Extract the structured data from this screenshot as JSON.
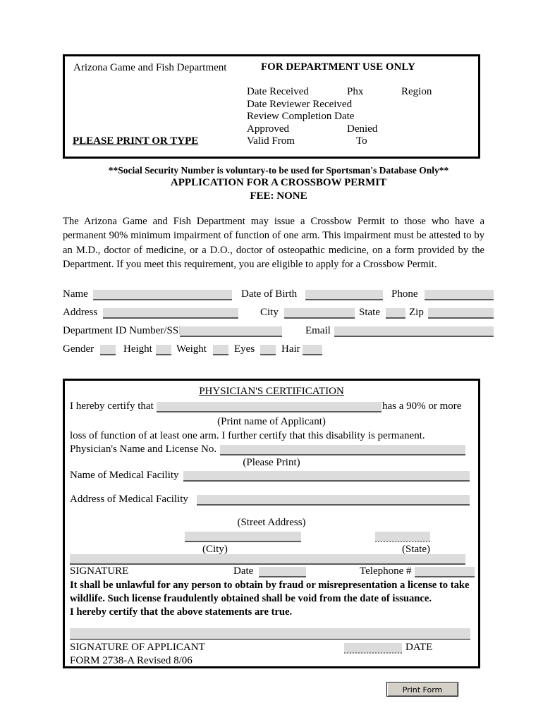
{
  "department_box": {
    "left_title": "Arizona Game and Fish Department",
    "right_title": "FOR DEPARTMENT USE ONLY",
    "please_print": "PLEASE PRINT OR TYPE",
    "rows": [
      {
        "c1": "Date Received",
        "c2": "Phx",
        "c3": "Region"
      },
      {
        "c1": "Date Reviewer Received",
        "c2": "",
        "c3": ""
      },
      {
        "c1": "Review Completion Date",
        "c2": "",
        "c3": ""
      },
      {
        "c1": "Approved",
        "c2": "Denied",
        "c3": ""
      },
      {
        "c1": "Valid From",
        "c2": "To",
        "c3": ""
      }
    ]
  },
  "titles": {
    "ssn_note": "**Social Security Number is voluntary-to be used for Sportsman's Database Only**",
    "application": "APPLICATION FOR A CROSSBOW PERMIT",
    "fee": "FEE:  NONE"
  },
  "intro": "The Arizona Game and Fish Department may issue a Crossbow Permit to those who have a permanent 90% minimum impairment of function of one arm.  This impairment must be attested to by an M.D., doctor of medicine, or a D.O., doctor of osteopathic medicine, on a form provided by the Department.  If you meet this requirement, you are eligible to apply for a Crossbow Permit.",
  "applicant": {
    "name_label": "Name",
    "dob_label": "Date of Birth",
    "phone_label": "Phone",
    "address_label": "Address",
    "city_label": "City",
    "state_label": "State",
    "zip_label": "Zip",
    "deptid_label": "Department ID Number/SSN:",
    "email_label": "Email",
    "gender_label": "Gender",
    "height_label": "Height",
    "weight_label": "Weight",
    "eyes_label": "Eyes",
    "hair_label": "Hair",
    "values": {
      "name": "",
      "dob": "",
      "phone": "",
      "address": "",
      "city": "",
      "state": "",
      "zip": "",
      "deptid": "",
      "email": "",
      "gender": "",
      "height": "",
      "weight": "",
      "eyes": "",
      "hair": ""
    }
  },
  "certification": {
    "title": "PHYSICIAN'S CERTIFICATION",
    "certify_prefix": "I hereby certify that",
    "certify_suffix": "has a 90% or more",
    "print_name_caption": "(Print name of Applicant)",
    "loss_line": "loss of function of at least one arm.  I further certify that this disability is permanent.",
    "physician_label": "Physician's Name and License No.",
    "please_print_caption": "(Please Print)",
    "facility_name_label": "Name of Medical Facility",
    "facility_address_label": "Address of Medical Facility",
    "street_caption": "(Street Address)",
    "city_caption": "(City)",
    "state_caption": "(State)",
    "signature_label": "SIGNATURE",
    "date_label": "Date",
    "telephone_label": "Telephone #",
    "warning_line_1": "It shall be unlawful for any person to obtain by fraud or misrepresentation a license to take",
    "warning_line_2": "wildlife.  Such license fraudulently obtained shall be void from the date of issuance.",
    "warning_line_3": "I hereby certify that the above statements are true.",
    "applicant_signature_label": "SIGNATURE OF APPLICANT",
    "applicant_date_label": "DATE",
    "form_number": "FORM 2738-A Revised 8/06",
    "values": {
      "applicant_name": "",
      "physician_name": "",
      "facility_name": "",
      "facility_address": "",
      "facility_city": "",
      "facility_state": "",
      "physician_signature": "",
      "physician_date": "",
      "physician_phone": "",
      "applicant_signature": "",
      "applicant_date": ""
    }
  },
  "print_button": {
    "label": "Print Form"
  },
  "colors": {
    "field_fill": "#dcdcdc",
    "field_underline": "#5a5a5a",
    "border": "#000000",
    "button_face": "#d4d0c8"
  }
}
